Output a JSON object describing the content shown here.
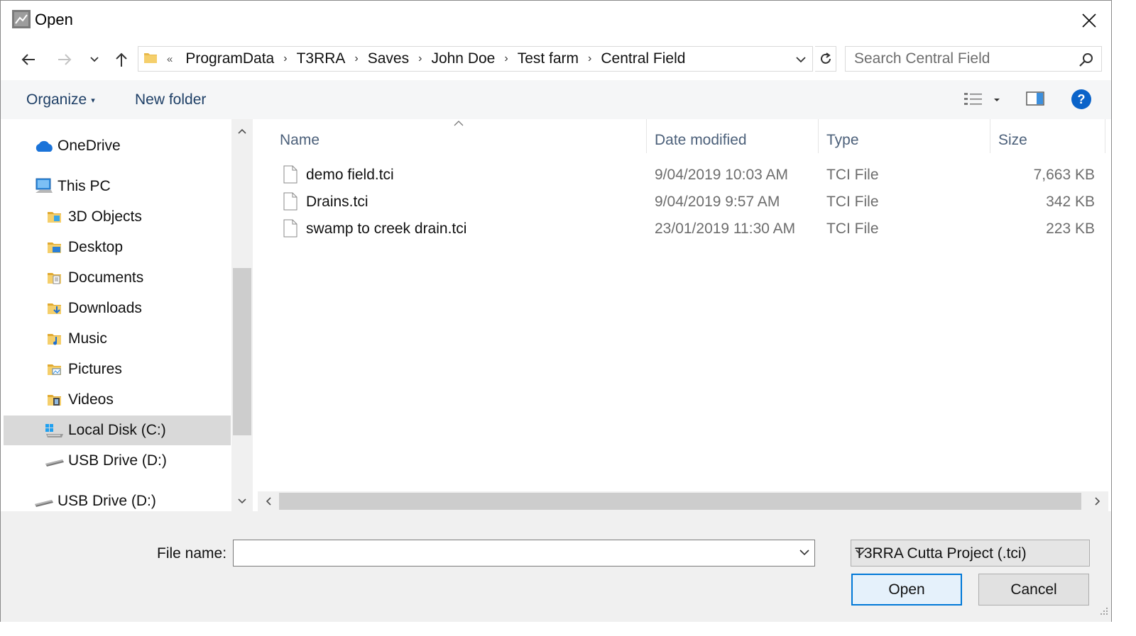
{
  "window": {
    "title": "Open"
  },
  "navigation": {
    "overflow_marker": "«",
    "breadcrumbs": [
      "ProgramData",
      "T3RRA",
      "Saves",
      "John Doe",
      "Test farm",
      "Central Field"
    ],
    "separator": "›"
  },
  "search": {
    "placeholder": "Search Central Field"
  },
  "toolbar": {
    "organize_label": "Organize",
    "new_folder_label": "New folder"
  },
  "nav_pane": {
    "items": [
      {
        "label": "OneDrive",
        "icon": "onedrive-icon",
        "level": 0
      },
      {
        "label": "This PC",
        "icon": "computer-icon",
        "level": 0
      },
      {
        "label": "3D Objects",
        "icon": "3d-objects-icon",
        "level": 1
      },
      {
        "label": "Desktop",
        "icon": "desktop-folder-icon",
        "level": 1
      },
      {
        "label": "Documents",
        "icon": "documents-folder-icon",
        "level": 1
      },
      {
        "label": "Downloads",
        "icon": "downloads-folder-icon",
        "level": 1
      },
      {
        "label": "Music",
        "icon": "music-folder-icon",
        "level": 1
      },
      {
        "label": "Pictures",
        "icon": "pictures-folder-icon",
        "level": 1
      },
      {
        "label": "Videos",
        "icon": "videos-folder-icon",
        "level": 1
      },
      {
        "label": "Local Disk (C:)",
        "icon": "local-disk-icon",
        "level": 1,
        "selected": true
      },
      {
        "label": "USB Drive (D:)",
        "icon": "usb-drive-icon",
        "level": 1
      },
      {
        "label": "USB Drive (D:)",
        "icon": "usb-drive-icon",
        "level": 0
      }
    ]
  },
  "file_list": {
    "columns": {
      "name": "Name",
      "date": "Date modified",
      "type": "Type",
      "size": "Size"
    },
    "files": [
      {
        "name": "demo field.tci",
        "date": "9/04/2019 10:03 AM",
        "type": "TCI File",
        "size": "7,663 KB"
      },
      {
        "name": "Drains.tci",
        "date": "9/04/2019 9:57 AM",
        "type": "TCI File",
        "size": "342 KB"
      },
      {
        "name": "swamp to creek drain.tci",
        "date": "23/01/2019 11:30 AM",
        "type": "TCI File",
        "size": "223 KB"
      }
    ]
  },
  "footer": {
    "file_name_label": "File name:",
    "file_name_value": "",
    "filter_value": "T3RRA Cutta Project (.tci)",
    "open_label": "Open",
    "cancel_label": "Cancel"
  },
  "colors": {
    "accent": "#0078d7",
    "selected_bg": "#d9d9d9",
    "header_text": "#4c607a",
    "toolbar_text": "#1e3f66"
  }
}
